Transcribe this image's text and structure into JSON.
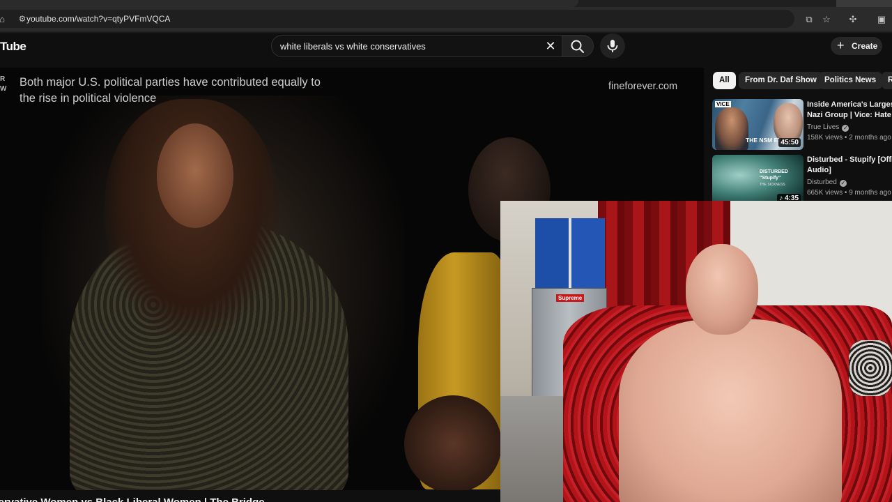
{
  "browser": {
    "url": "youtube.com/watch?v=qtyPVFmVQCA"
  },
  "header": {
    "logo_text": "Tube",
    "search_query": "white liberals vs white conservatives",
    "create_label": "Create"
  },
  "video": {
    "caption": "Both major U.S. political parties have contributed equally to the rise in political violence",
    "watermark": "fineforever.com",
    "channel_mark": "R\nW",
    "title_partial": "nservative Women vs Black Liberal Women | The Bridge"
  },
  "chips": [
    "All",
    "From Dr. Daf Show",
    "Politics News",
    "R"
  ],
  "recommendations": [
    {
      "title_line1": "Inside America's Largest",
      "title_line2": "Nazi Group | Vice: Hate T",
      "channel": "True Lives",
      "meta": "158K views • 2 months ago",
      "duration": "45:50",
      "thumb_badge": "VICE",
      "thumb_text": "THE NSM EXPO"
    },
    {
      "title_line1": "Disturbed - Stupify [Offici",
      "title_line2": "Audio]",
      "channel": "Disturbed",
      "meta": "665K views • 9 months ago",
      "duration": "4:35",
      "thumb_text": "DISTURBED",
      "thumb_sub": "\"Stupify\"",
      "thumb_small": "THE SICKNESS"
    }
  ],
  "webcam": {
    "sticker_text": "Supreme"
  },
  "colors": {
    "background": "#0f0f0f",
    "chip_active": "#f1f1f1",
    "chip_inactive": "#272727"
  }
}
